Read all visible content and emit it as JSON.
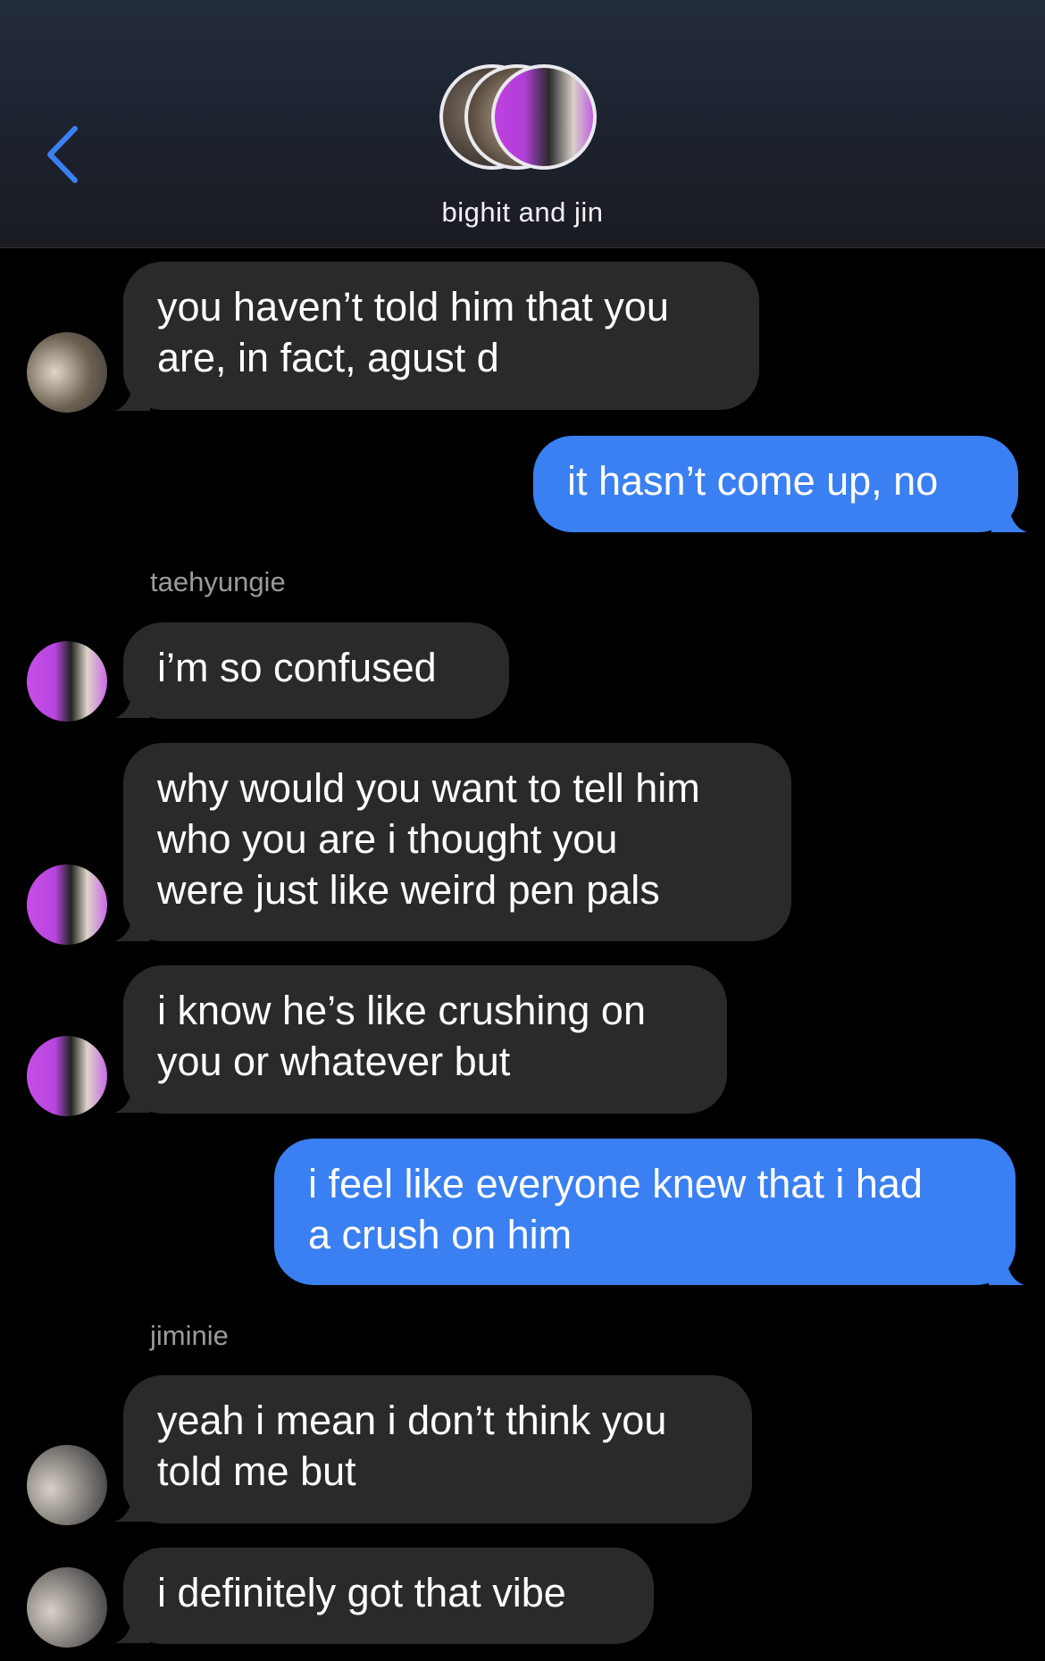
{
  "header": {
    "title": "bighit and jin",
    "back_icon": "chevron-left-icon",
    "accent": "#3a80f2"
  },
  "messages": [
    {
      "direction": "incoming",
      "lines": [
        "you haven’t told him that you",
        "are, in fact, agust d"
      ]
    },
    {
      "direction": "outgoing",
      "lines": [
        "it hasn’t come up, no"
      ]
    },
    {
      "sender": "taehyungie"
    },
    {
      "direction": "incoming",
      "lines": [
        "i’m so confused"
      ]
    },
    {
      "direction": "incoming",
      "lines": [
        "why would you want to tell him",
        "who you are i thought you",
        "were just like weird pen pals"
      ]
    },
    {
      "direction": "incoming",
      "lines": [
        "i know he’s like crushing on",
        "you or whatever but"
      ]
    },
    {
      "direction": "outgoing",
      "lines": [
        "i feel like everyone knew that i had",
        "a crush on him"
      ]
    },
    {
      "sender": "jiminie"
    },
    {
      "direction": "incoming",
      "lines": [
        "yeah i mean i don’t think you",
        "told me but"
      ]
    },
    {
      "direction": "incoming",
      "lines": [
        "i definitely got that vibe"
      ]
    }
  ],
  "colors": {
    "incoming_bubble": "#2a2a2c",
    "outgoing_bubble": "#3a80f2",
    "background": "#000000"
  }
}
